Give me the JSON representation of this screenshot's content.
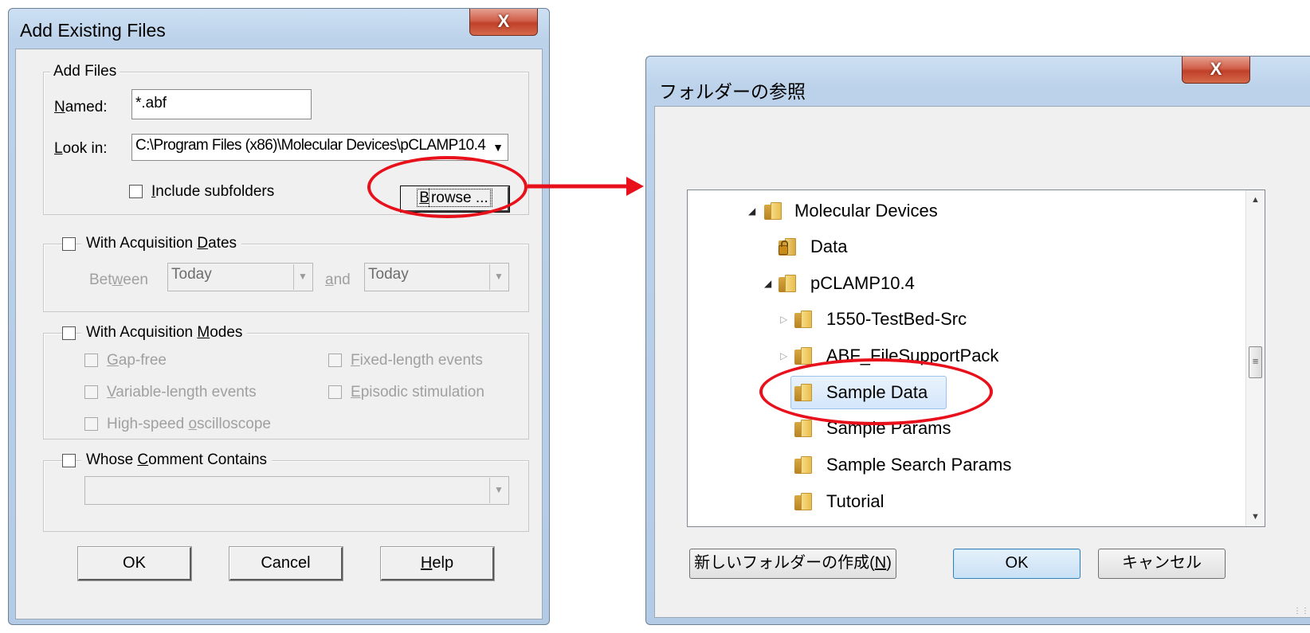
{
  "left_dialog": {
    "title": "Add Existing Files",
    "close_glyph": "X",
    "add_files": {
      "legend": "Add Files",
      "named_label_mnemonic": "N",
      "named_label_rest": "amed:",
      "named_value": "*.abf",
      "lookin_label_mnemonic": "L",
      "lookin_label_rest": "ook in:",
      "lookin_value": "C:\\Program Files (x86)\\Molecular Devices\\pCLAMP10.4",
      "include_subfolders_mnemonic": "I",
      "include_subfolders_rest": "nclude subfolders",
      "include_subfolders_checked": false,
      "browse_mnemonic": "B",
      "browse_rest": "rowse ..."
    },
    "dates": {
      "legend_pre": "With Acquisition ",
      "legend_mnemonic": "D",
      "legend_post": "ates",
      "checked": false,
      "between_pre": "Bet",
      "between_mnemonic": "w",
      "between_post": "een",
      "from_value": "Today",
      "and_mnemonic": "a",
      "and_rest": "nd",
      "to_value": "Today"
    },
    "modes": {
      "legend_pre": "With Acquisition ",
      "legend_mnemonic": "M",
      "legend_post": "odes",
      "checked": false,
      "gapfree_mnemonic": "G",
      "gapfree_rest": "ap-free",
      "fixed_mnemonic": "F",
      "fixed_rest": "ixed-length events",
      "variable_mnemonic": "V",
      "variable_rest": "ariable-length events",
      "episodic_mnemonic": "E",
      "episodic_rest": "pisodic stimulation",
      "highspeed_pre": "High-speed ",
      "highspeed_mnemonic": "o",
      "highspeed_rest": "scilloscope"
    },
    "comment": {
      "legend_pre": "Whose ",
      "legend_mnemonic": "C",
      "legend_post": "omment Contains",
      "checked": false,
      "value": ""
    },
    "buttons": {
      "ok": "OK",
      "cancel": "Cancel",
      "help_mnemonic": "H",
      "help_rest": "elp"
    }
  },
  "right_dialog": {
    "title": "フォルダーの参照",
    "close_glyph": "X",
    "tree": [
      {
        "label": "Molecular Devices",
        "expander": "open",
        "icon": "folder-icon"
      },
      {
        "label": "Data",
        "expander": "none",
        "icon": "locked-folder-icon"
      },
      {
        "label": "pCLAMP10.4",
        "expander": "open",
        "icon": "folder-icon"
      },
      {
        "label": "1550-TestBed-Src",
        "expander": "closed",
        "icon": "folder-icon"
      },
      {
        "label": "ABF_FileSupportPack",
        "expander": "closed",
        "icon": "folder-icon"
      },
      {
        "label": "Sample Data",
        "expander": "none",
        "icon": "folder-icon",
        "selected": true
      },
      {
        "label": "Sample Params",
        "expander": "none",
        "icon": "folder-icon"
      },
      {
        "label": "Sample Search Params",
        "expander": "none",
        "icon": "folder-icon"
      },
      {
        "label": "Tutorial",
        "expander": "none",
        "icon": "folder-icon"
      }
    ],
    "buttons": {
      "new_folder_pre": "新しいフォルダーの作成(",
      "new_folder_mnemonic": "N",
      "new_folder_post": ")",
      "ok": "OK",
      "cancel": "キャンセル"
    }
  },
  "annotation": {
    "color": "#e8101a"
  }
}
